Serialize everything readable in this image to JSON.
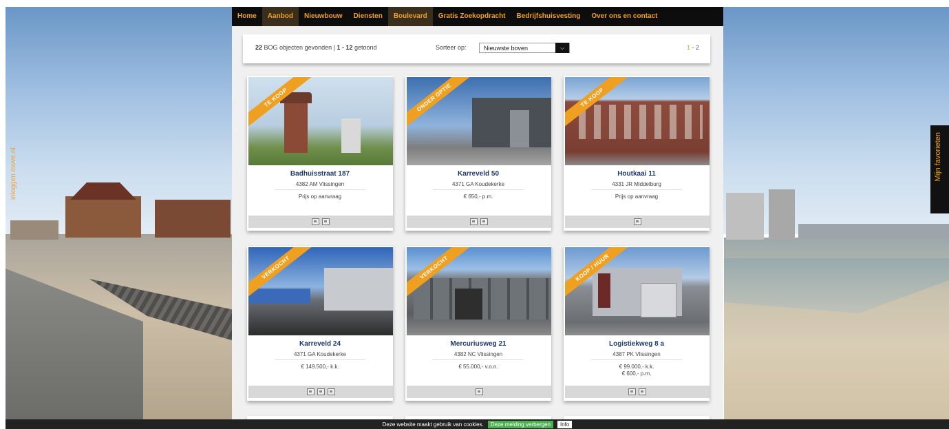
{
  "side": {
    "left_label": "inloggen move.nl",
    "favorites_label": "Mijn favorieten"
  },
  "nav": {
    "items": [
      {
        "label": "Home"
      },
      {
        "label": "Aanbod"
      },
      {
        "label": "Nieuwbouw"
      },
      {
        "label": "Diensten"
      },
      {
        "label": "Boulevard"
      },
      {
        "label": "Gratis Zoekopdracht"
      },
      {
        "label": "Bedrijfshuisvesting"
      },
      {
        "label": "Over ons en contact"
      }
    ],
    "active": [
      "Aanbod",
      "Boulevard"
    ]
  },
  "toolbar": {
    "count": "22",
    "found_text": "BOG objecten gevonden |",
    "range": "1 - 12",
    "shown_text": "getoond",
    "sort_label": "Sorteer op:",
    "sort_value": "Nieuwste boven",
    "page_current": "1",
    "page_sep": " - ",
    "page_next": "2"
  },
  "listings": [
    {
      "ribbon": "TE KOOP",
      "title": "Badhuisstraat 187",
      "address": "4382 AM Vlissingen",
      "price": "Prijs op aanvraag",
      "price2": ""
    },
    {
      "ribbon": "ONDER OPTIE",
      "title": "Karreveld 50",
      "address": "4371 GA Koudekerke",
      "price": "€ 650,- p.m.",
      "price2": ""
    },
    {
      "ribbon": "TE KOOP",
      "title": "Houtkaai 11",
      "address": "4331 JR Middelburg",
      "price": "Prijs op aanvraag",
      "price2": ""
    },
    {
      "ribbon": "VERKOCHT",
      "title": "Karreveld 24",
      "address": "4371 GA Koudekerke",
      "price": "€ 149.500,- k.k.",
      "price2": ""
    },
    {
      "ribbon": "VERKOCHT",
      "title": "Mercuriusweg 21",
      "address": "4382 NC Vlissingen",
      "price": "€ 55.000,- v.o.n.",
      "price2": ""
    },
    {
      "ribbon": "KOOP / HUUR",
      "title": "Logistiekweg 8 a",
      "address": "4387 PK Vlissingen",
      "price": "€ 99.000,- k.k.",
      "price2": "€ 600,- p.m."
    }
  ],
  "cookie": {
    "text": "Deze website maakt gebruik van cookies.",
    "hide_label": "Deze melding verbergen",
    "info_label": "Info"
  },
  "colors": {
    "accent": "#f0a020",
    "title": "#1e3a6e",
    "nav_bg": "#0d0d0d"
  }
}
